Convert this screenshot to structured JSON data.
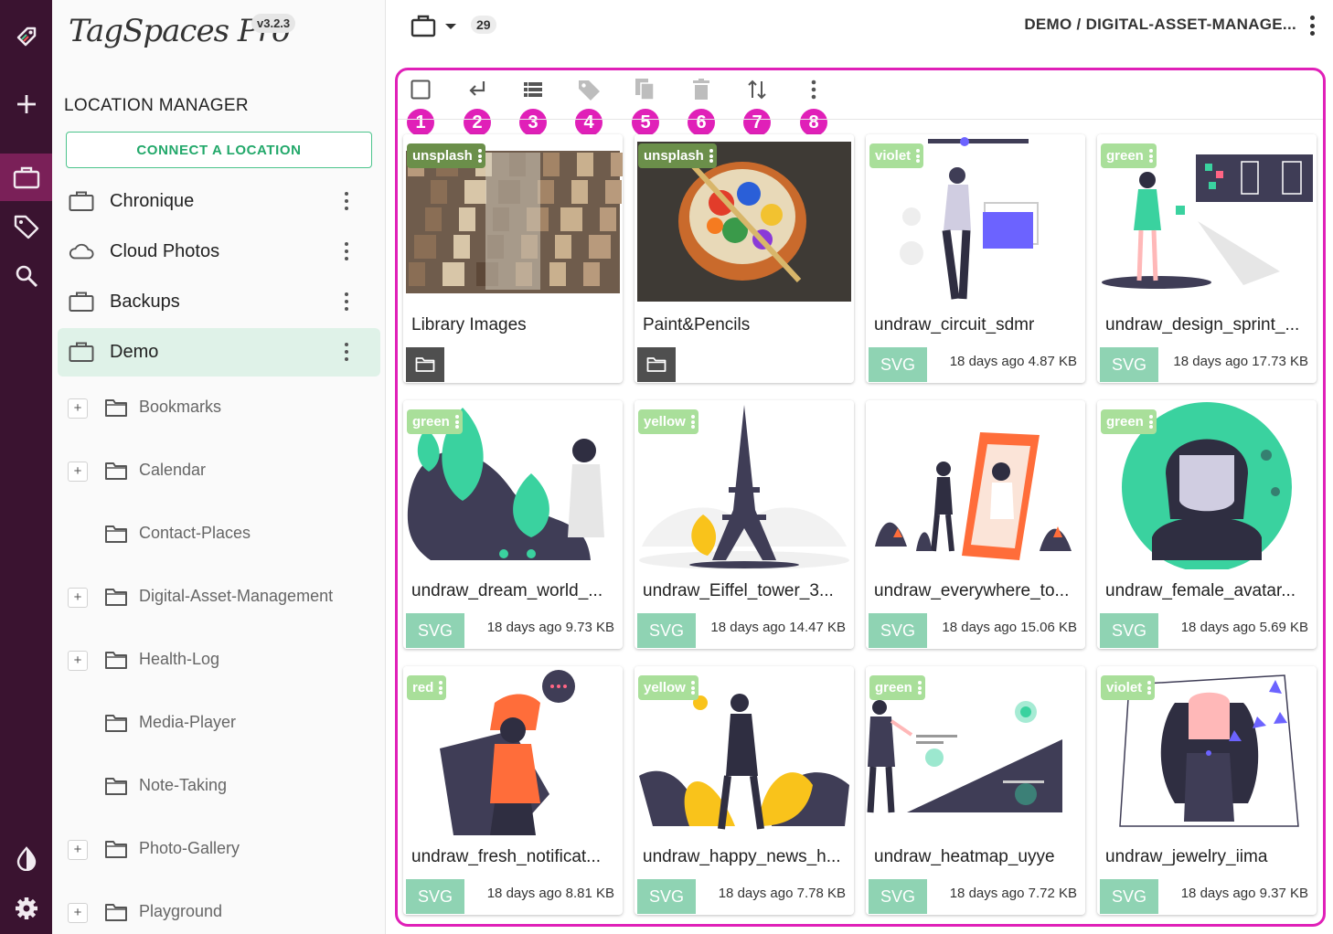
{
  "app": {
    "logo_text": "TagSpaces Pro",
    "version": "v3.2.3"
  },
  "panel": {
    "title": "LOCATION MANAGER",
    "connect_label": "CONNECT A LOCATION",
    "locations": [
      {
        "label": "Chronique",
        "icon": "briefcase-icon"
      },
      {
        "label": "Cloud Photos",
        "icon": "cloud-icon"
      },
      {
        "label": "Backups",
        "icon": "briefcase-icon"
      },
      {
        "label": "Demo",
        "icon": "briefcase-icon",
        "active": true
      }
    ],
    "folders": [
      {
        "label": "Bookmarks",
        "expandable": true
      },
      {
        "label": "Calendar",
        "expandable": true
      },
      {
        "label": "Contact-Places",
        "expandable": false
      },
      {
        "label": "Digital-Asset-Management",
        "expandable": true
      },
      {
        "label": "Health-Log",
        "expandable": true
      },
      {
        "label": "Media-Player",
        "expandable": false
      },
      {
        "label": "Note-Taking",
        "expandable": false
      },
      {
        "label": "Photo-Gallery",
        "expandable": true
      },
      {
        "label": "Playground",
        "expandable": true
      }
    ]
  },
  "topbar": {
    "count": "29",
    "breadcrumb": "DEMO /  DIGITAL-ASSET-MANAGE..."
  },
  "toolbar": {
    "badges": [
      "1",
      "2",
      "3",
      "4",
      "5",
      "6",
      "7",
      "8"
    ],
    "buttons": [
      "select-all-checkbox-icon",
      "parent-folder-icon",
      "view-list-icon",
      "tag-icon",
      "copy-icon",
      "delete-icon",
      "sort-icon",
      "more-vert-icon"
    ]
  },
  "expand_symbol": "+",
  "cards": [
    {
      "tag": "unsplash",
      "tag_color": "#6b8f4a",
      "name": "Library Images",
      "is_folder": true
    },
    {
      "tag": "unsplash",
      "tag_color": "#6b8f4a",
      "name": "Paint&Pencils",
      "is_folder": true
    },
    {
      "tag": "violet",
      "tag_color": "#a9df9a",
      "name": "undraw_circuit_sdmr",
      "ext": "SVG",
      "meta": "18 days ago 4.87 KB"
    },
    {
      "tag": "green",
      "tag_color": "#a9df9a",
      "name": "undraw_design_sprint_...",
      "ext": "SVG",
      "meta": "18 days ago 17.73 KB"
    },
    {
      "tag": "green",
      "tag_color": "#a9df9a",
      "name": "undraw_dream_world_...",
      "ext": "SVG",
      "meta": "18 days ago 9.73 KB"
    },
    {
      "tag": "yellow",
      "tag_color": "#a9df9a",
      "name": "undraw_Eiffel_tower_3...",
      "ext": "SVG",
      "meta": "18 days ago 14.47 KB"
    },
    {
      "tag": "",
      "tag_color": "",
      "name": "undraw_everywhere_to...",
      "ext": "SVG",
      "meta": "18 days ago 15.06 KB"
    },
    {
      "tag": "green",
      "tag_color": "#a9df9a",
      "name": "undraw_female_avatar...",
      "ext": "SVG",
      "meta": "18 days ago 5.69 KB"
    },
    {
      "tag": "red",
      "tag_color": "#a9df9a",
      "name": "undraw_fresh_notificat...",
      "ext": "SVG",
      "meta": "18 days ago 8.81 KB"
    },
    {
      "tag": "yellow",
      "tag_color": "#a9df9a",
      "name": "undraw_happy_news_h...",
      "ext": "SVG",
      "meta": "18 days ago 7.78 KB"
    },
    {
      "tag": "green",
      "tag_color": "#a9df9a",
      "name": "undraw_heatmap_uyye",
      "ext": "SVG",
      "meta": "18 days ago 7.72 KB"
    },
    {
      "tag": "violet",
      "tag_color": "#a9df9a",
      "name": "undraw_jewelry_iima",
      "ext": "SVG",
      "meta": "18 days ago 9.37 KB"
    }
  ],
  "colors": {
    "appbar_bg": "#3a1330",
    "appbar_active": "#7a2058",
    "accent_green": "#22a86a",
    "highlight_pink": "#e020b8",
    "ext_badge": "#8fd3b3"
  }
}
